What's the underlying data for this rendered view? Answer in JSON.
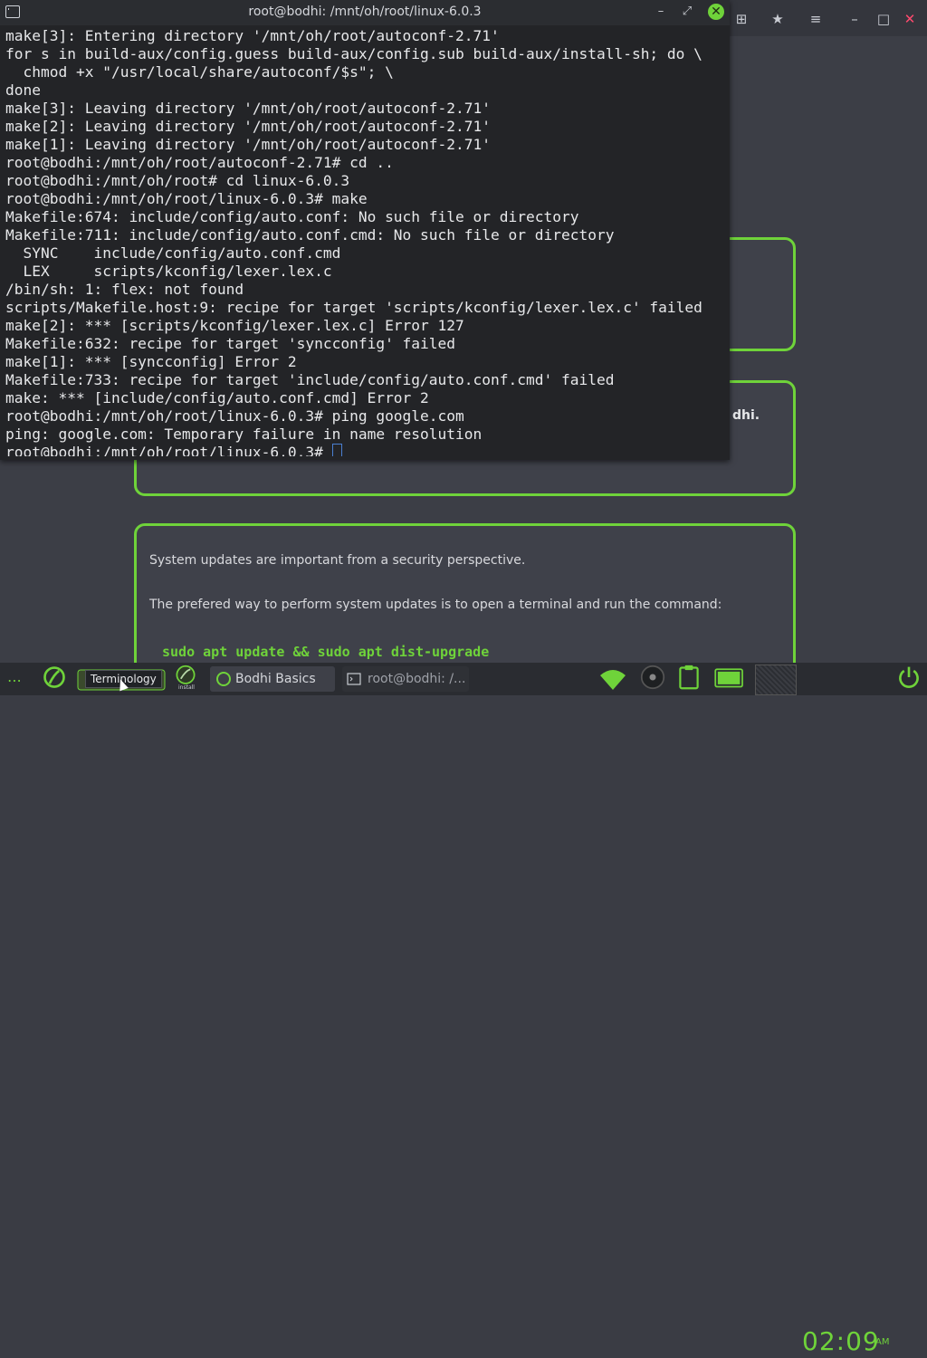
{
  "terminal": {
    "title": "root@bodhi: /mnt/oh/root/linux-6.0.3",
    "lines": [
      "make[3]: Entering directory '/mnt/oh/root/autoconf-2.71'",
      "for s in build-aux/config.guess build-aux/config.sub build-aux/install-sh; do \\",
      "  chmod +x \"/usr/local/share/autoconf/$s\"; \\",
      "done",
      "make[3]: Leaving directory '/mnt/oh/root/autoconf-2.71'",
      "make[2]: Leaving directory '/mnt/oh/root/autoconf-2.71'",
      "make[1]: Leaving directory '/mnt/oh/root/autoconf-2.71'",
      "root@bodhi:/mnt/oh/root/autoconf-2.71# cd ..",
      "root@bodhi:/mnt/oh/root# cd linux-6.0.3",
      "root@bodhi:/mnt/oh/root/linux-6.0.3# make",
      "Makefile:674: include/config/auto.conf: No such file or directory",
      "Makefile:711: include/config/auto.conf.cmd: No such file or directory",
      "  SYNC    include/config/auto.conf.cmd",
      "  LEX     scripts/kconfig/lexer.lex.c",
      "/bin/sh: 1: flex: not found",
      "scripts/Makefile.host:9: recipe for target 'scripts/kconfig/lexer.lex.c' failed",
      "make[2]: *** [scripts/kconfig/lexer.lex.c] Error 127",
      "Makefile:632: recipe for target 'syncconfig' failed",
      "make[1]: *** [syncconfig] Error 2",
      "Makefile:733: recipe for target 'include/config/auto.conf.cmd' failed",
      "make: *** [include/config/auto.conf.cmd] Error 2",
      "root@bodhi:/mnt/oh/root/linux-6.0.3# ping google.com",
      "ping: google.com: Temporary failure in name resolution"
    ],
    "prompt": "root@bodhi:/mnt/oh/root/linux-6.0.3# "
  },
  "background_page": {
    "card2_fragment": "dhi.",
    "card3_text1": "System updates are important from a security perspective.",
    "card3_text2": "The prefered way to perform system updates is to open a terminal and run the command:",
    "card3_code": "sudo apt update && sudo apt dist-upgrade"
  },
  "taskbar": {
    "tooltip": "Terminology",
    "tasks": [
      {
        "label": "Bodhi Basics"
      },
      {
        "label": "root@bodhi: /..."
      }
    ],
    "install_label": "install",
    "clock": "02:09",
    "ampm": "AM"
  },
  "colors": {
    "accent": "#6fd33a",
    "terminal_bg": "#232427",
    "desktop_bg": "#3c3e46"
  }
}
